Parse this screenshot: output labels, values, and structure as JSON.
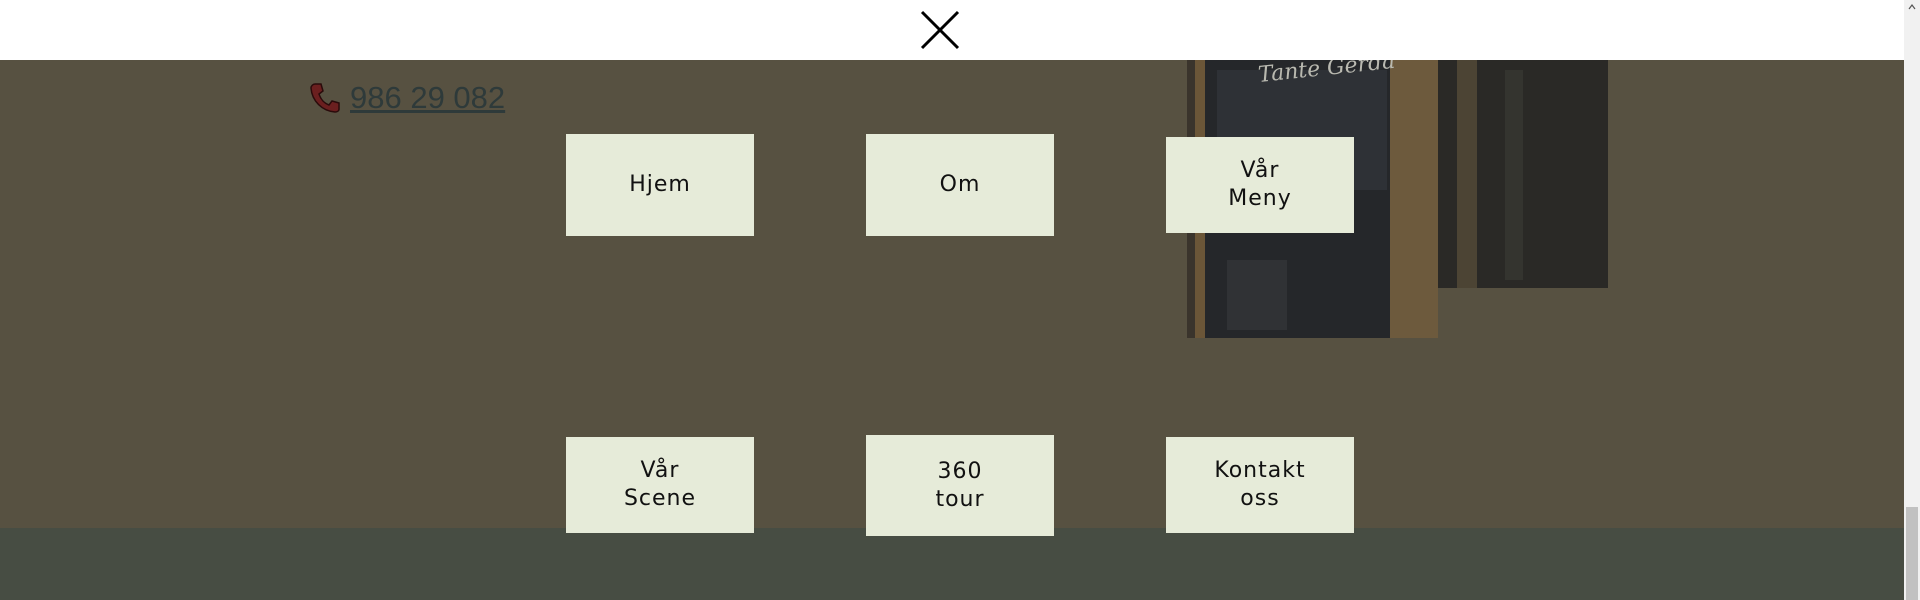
{
  "phone": {
    "number": "986 29 082",
    "icon": "phone-icon"
  },
  "photo": {
    "sign_text": "Tante Gerda"
  },
  "nav": {
    "home": "Hjem",
    "about": "Om",
    "menu": "Vår\nMeny",
    "stage": "Vår\nScene",
    "tour": "360\ntour",
    "contact": "Kontakt\noss"
  },
  "icons": {
    "close": "close-icon",
    "scroll_up": "scroll-up-arrow-icon"
  },
  "colors": {
    "overlay_background": "#575141",
    "button_background": "#e6ebd9",
    "phone_link": "#2e3a3a",
    "phone_icon": "#6b1f1f",
    "footer_band": "#474d43"
  }
}
